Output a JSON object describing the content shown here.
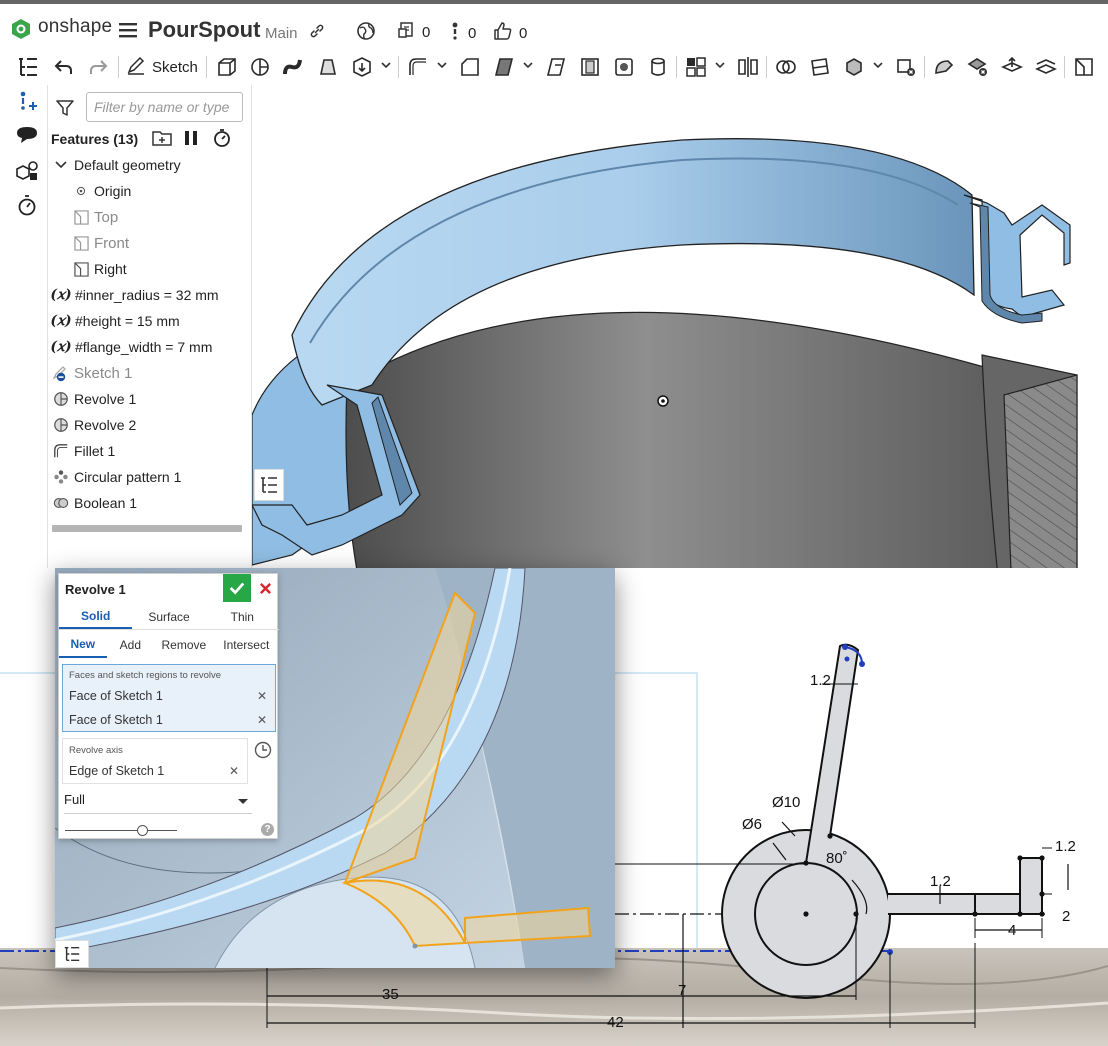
{
  "app": {
    "brand": "onshape",
    "doc_title": "PourSpout",
    "branch": "Main",
    "versions_count": "0",
    "pointers_count": "0",
    "likes_count": "0"
  },
  "icons": {
    "logo": "onshape-logo-icon",
    "menu": "hamburger-menu-icon",
    "link": "link-icon",
    "globe": "globe-icon",
    "versions": "versions-icon",
    "pointers": "follow-icon",
    "likes": "thumbs-up-icon"
  },
  "toolbar": {
    "sketch_label": "Sketch"
  },
  "feature_panel": {
    "filter_placeholder": "Filter by name or type",
    "header": "Features (13)",
    "items": [
      {
        "label": "Default geometry",
        "kind": "group"
      },
      {
        "label": "Origin",
        "kind": "origin"
      },
      {
        "label": "Top",
        "kind": "plane",
        "dim": true
      },
      {
        "label": "Front",
        "kind": "plane",
        "dim": true
      },
      {
        "label": "Right",
        "kind": "plane"
      },
      {
        "label": "#inner_radius = 32 mm",
        "kind": "variable"
      },
      {
        "label": "#height = 15 mm",
        "kind": "variable"
      },
      {
        "label": "#flange_width = 7 mm",
        "kind": "variable"
      },
      {
        "label": "Sketch 1",
        "kind": "sketch",
        "dim": true
      },
      {
        "label": "Revolve 1",
        "kind": "revolve"
      },
      {
        "label": "Revolve 2",
        "kind": "revolve"
      },
      {
        "label": "Fillet 1",
        "kind": "fillet"
      },
      {
        "label": "Circular pattern 1",
        "kind": "pattern"
      },
      {
        "label": "Boolean 1",
        "kind": "boolean"
      }
    ]
  },
  "revolve_dialog": {
    "title": "Revolve 1",
    "body_tabs": [
      "Solid",
      "Surface",
      "Thin"
    ],
    "active_body_tab": "Solid",
    "op_tabs": [
      "New",
      "Add",
      "Remove",
      "Intersect"
    ],
    "active_op_tab": "New",
    "faces_label": "Faces and sketch regions to revolve",
    "faces": [
      "Face of Sketch 1",
      "Face of Sketch 1"
    ],
    "axis_label": "Revolve axis",
    "axis_value": "Edge of Sketch 1",
    "revolve_type": "Full"
  },
  "drawing": {
    "dims": [
      "1.2",
      "Ø10",
      "Ø6",
      "80˚",
      "1.2",
      "1.2",
      "2",
      "4",
      "35",
      "7",
      "42"
    ]
  },
  "colors": {
    "part_blue": "#8fbde3",
    "part_dark": "#5e87ab",
    "cut_gray": "#8c8c8c",
    "selection_orange": "#f2a31b",
    "ok_green": "#27a745",
    "cancel_red": "#d9262c",
    "accent_blue": "#1a5fb4"
  }
}
